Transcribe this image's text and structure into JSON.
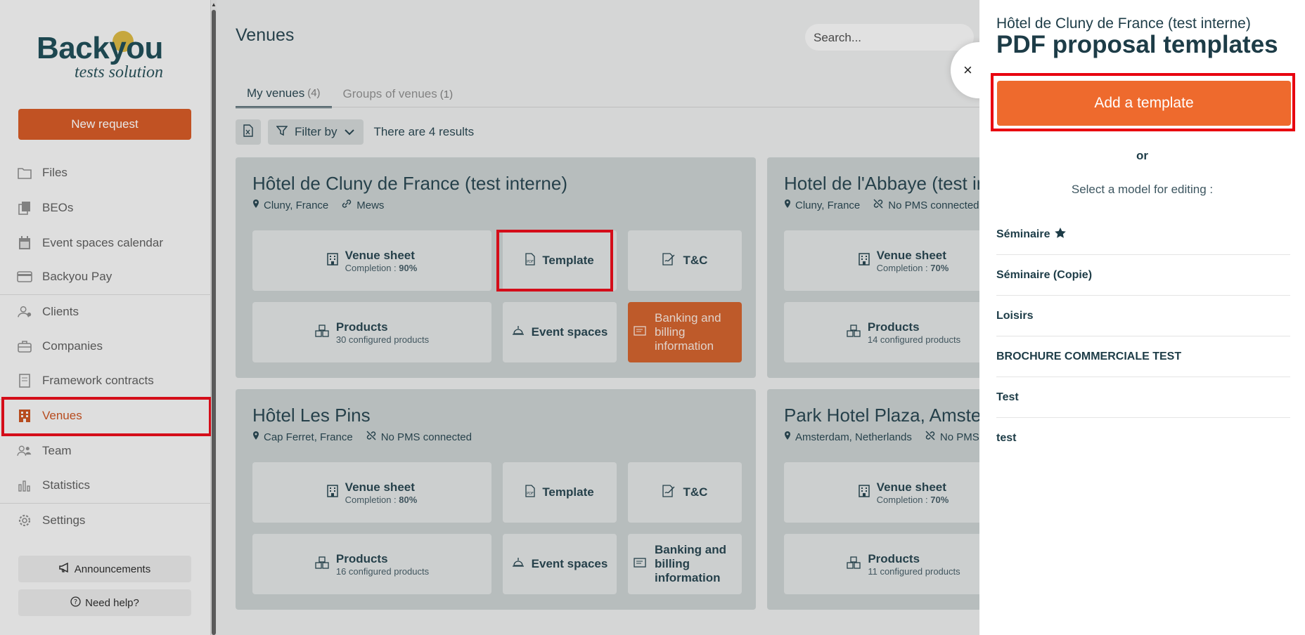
{
  "sidebar": {
    "logo_main": "Backyou",
    "logo_sub": "tests solution",
    "new_request": "New request",
    "items": [
      {
        "label": "Files",
        "icon": "folder-icon"
      },
      {
        "label": "BEOs",
        "icon": "documents-icon"
      },
      {
        "label": "Event spaces calendar",
        "icon": "calendar-icon"
      },
      {
        "label": "Backyou Pay",
        "icon": "credit-card-icon"
      },
      {
        "label": "Clients",
        "icon": "users-icon"
      },
      {
        "label": "Companies",
        "icon": "briefcase-icon"
      },
      {
        "label": "Framework contracts",
        "icon": "contract-icon"
      },
      {
        "label": "Venues",
        "icon": "building-icon"
      },
      {
        "label": "Team",
        "icon": "team-icon"
      },
      {
        "label": "Statistics",
        "icon": "bar-chart-icon"
      },
      {
        "label": "Settings",
        "icon": "gear-icon"
      }
    ],
    "announcements": "Announcements",
    "need_help": "Need help?"
  },
  "main": {
    "title": "Venues",
    "search_placeholder": "Search...",
    "tabs": [
      {
        "label": "My venues",
        "count": "(4)"
      },
      {
        "label": "Groups of venues",
        "count": "(1)"
      }
    ],
    "filter_label": "Filter by",
    "results": "There are 4 results",
    "venues": [
      {
        "name": "Hôtel de Cluny de France (test interne)",
        "location": "Cluny, France",
        "pms": "Mews",
        "venue_sheet": "Venue sheet",
        "completion_label": "Completion :",
        "completion": "90%",
        "template": "Template",
        "tc": "T&C",
        "products": "Products",
        "products_count": "30 configured products",
        "event_spaces": "Event spaces",
        "banking": "Banking and billing information"
      },
      {
        "name": "Hotel de l'Abbaye (test in",
        "location": "Cluny, France",
        "pms": "No PMS connected",
        "venue_sheet": "Venue sheet",
        "completion_label": "Completion :",
        "completion": "70%",
        "products": "Products",
        "products_count": "14 configured products"
      },
      {
        "name": "Hôtel Les Pins",
        "location": "Cap Ferret, France",
        "pms": "No PMS connected",
        "venue_sheet": "Venue sheet",
        "completion_label": "Completion :",
        "completion": "80%",
        "template": "Template",
        "tc": "T&C",
        "products": "Products",
        "products_count": "16 configured products",
        "event_spaces": "Event spaces",
        "banking": "Banking and billing information"
      },
      {
        "name": "Park Hotel Plaza, Amster",
        "location": "Amsterdam, Netherlands",
        "pms": "No PMS",
        "venue_sheet": "Venue sheet",
        "completion_label": "Completion :",
        "completion": "70%",
        "products": "Products",
        "products_count": "11 configured products"
      }
    ]
  },
  "panel": {
    "venue": "Hôtel de Cluny de France (test interne)",
    "title": "PDF proposal templates",
    "add_button": "Add a template",
    "or": "or",
    "select_label": "Select a model for editing :",
    "templates": [
      "Séminaire",
      "Séminaire (Copie)",
      "Loisirs",
      "BROCHURE COMMERCIALE TEST",
      "Test",
      "test"
    ],
    "close": "×"
  },
  "colors": {
    "accent": "#ee6a2d",
    "brand_dark": "#1d3c47",
    "highlight": "#e8000f"
  }
}
